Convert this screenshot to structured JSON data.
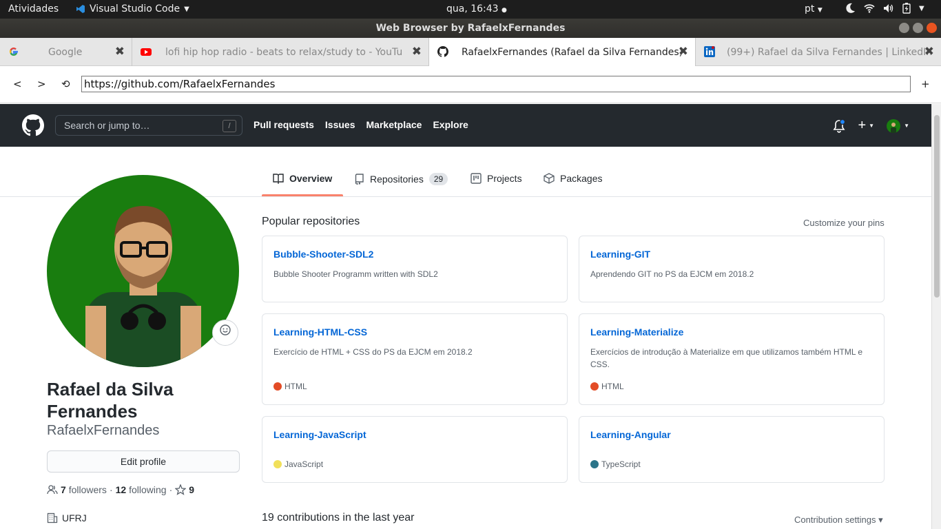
{
  "topbar": {
    "activities": "Atividades",
    "app_name": "Visual Studio Code",
    "clock": "qua, 16:43",
    "lang": "pt"
  },
  "window": {
    "title": "Web Browser by RafaelxFernandes"
  },
  "tabs": [
    {
      "title": "Google",
      "icon": "google-icon"
    },
    {
      "title": "lofi hip hop radio - beats to relax/study to - YouTube",
      "icon": "youtube-icon"
    },
    {
      "title": "RafaelxFernandes (Rafael da Silva Fernandes)",
      "icon": "github-icon"
    },
    {
      "title": "(99+) Rafael da Silva Fernandes | LinkedIn",
      "icon": "linkedin-icon"
    }
  ],
  "nav": {
    "back": "<",
    "forward": ">",
    "reload": "⟲",
    "url": "https://github.com/RafaelxFernandes",
    "new_tab": "+"
  },
  "github": {
    "search_placeholder": "Search or jump to…",
    "search_key": "/",
    "nav": [
      "Pull requests",
      "Issues",
      "Marketplace",
      "Explore"
    ],
    "tabs": {
      "overview": "Overview",
      "repositories": "Repositories",
      "repositories_count": "29",
      "projects": "Projects",
      "packages": "Packages"
    },
    "profile": {
      "name": "Rafael da Silva Fernandes",
      "login": "RafaelxFernandes",
      "edit_profile": "Edit profile",
      "followers_count": "7",
      "followers_label": "followers",
      "following_count": "12",
      "following_label": "following",
      "stars": "9",
      "org": "UFRJ"
    },
    "popular_title": "Popular repositories",
    "customize": "Customize your pins",
    "repos": [
      {
        "name": "Bubble-Shooter-SDL2",
        "desc": "Bubble Shooter Programm written with SDL2",
        "lang": "",
        "lang_color": ""
      },
      {
        "name": "Learning-GIT",
        "desc": "Aprendendo GIT no PS da EJCM em 2018.2",
        "lang": "",
        "lang_color": ""
      },
      {
        "name": "Learning-HTML-CSS",
        "desc": "Exercício de HTML + CSS do PS da EJCM em 2018.2",
        "lang": "HTML",
        "lang_color": "#e34c26"
      },
      {
        "name": "Learning-Materialize",
        "desc": "Exercícios de introdução à Materialize em que utilizamos também HTML e CSS.",
        "lang": "HTML",
        "lang_color": "#e34c26"
      },
      {
        "name": "Learning-JavaScript",
        "desc": "",
        "lang": "JavaScript",
        "lang_color": "#f1e05a"
      },
      {
        "name": "Learning-Angular",
        "desc": "",
        "lang": "TypeScript",
        "lang_color": "#2b7489"
      }
    ],
    "contributions": "19 contributions in the last year",
    "contribution_settings": "Contribution settings ▾"
  }
}
